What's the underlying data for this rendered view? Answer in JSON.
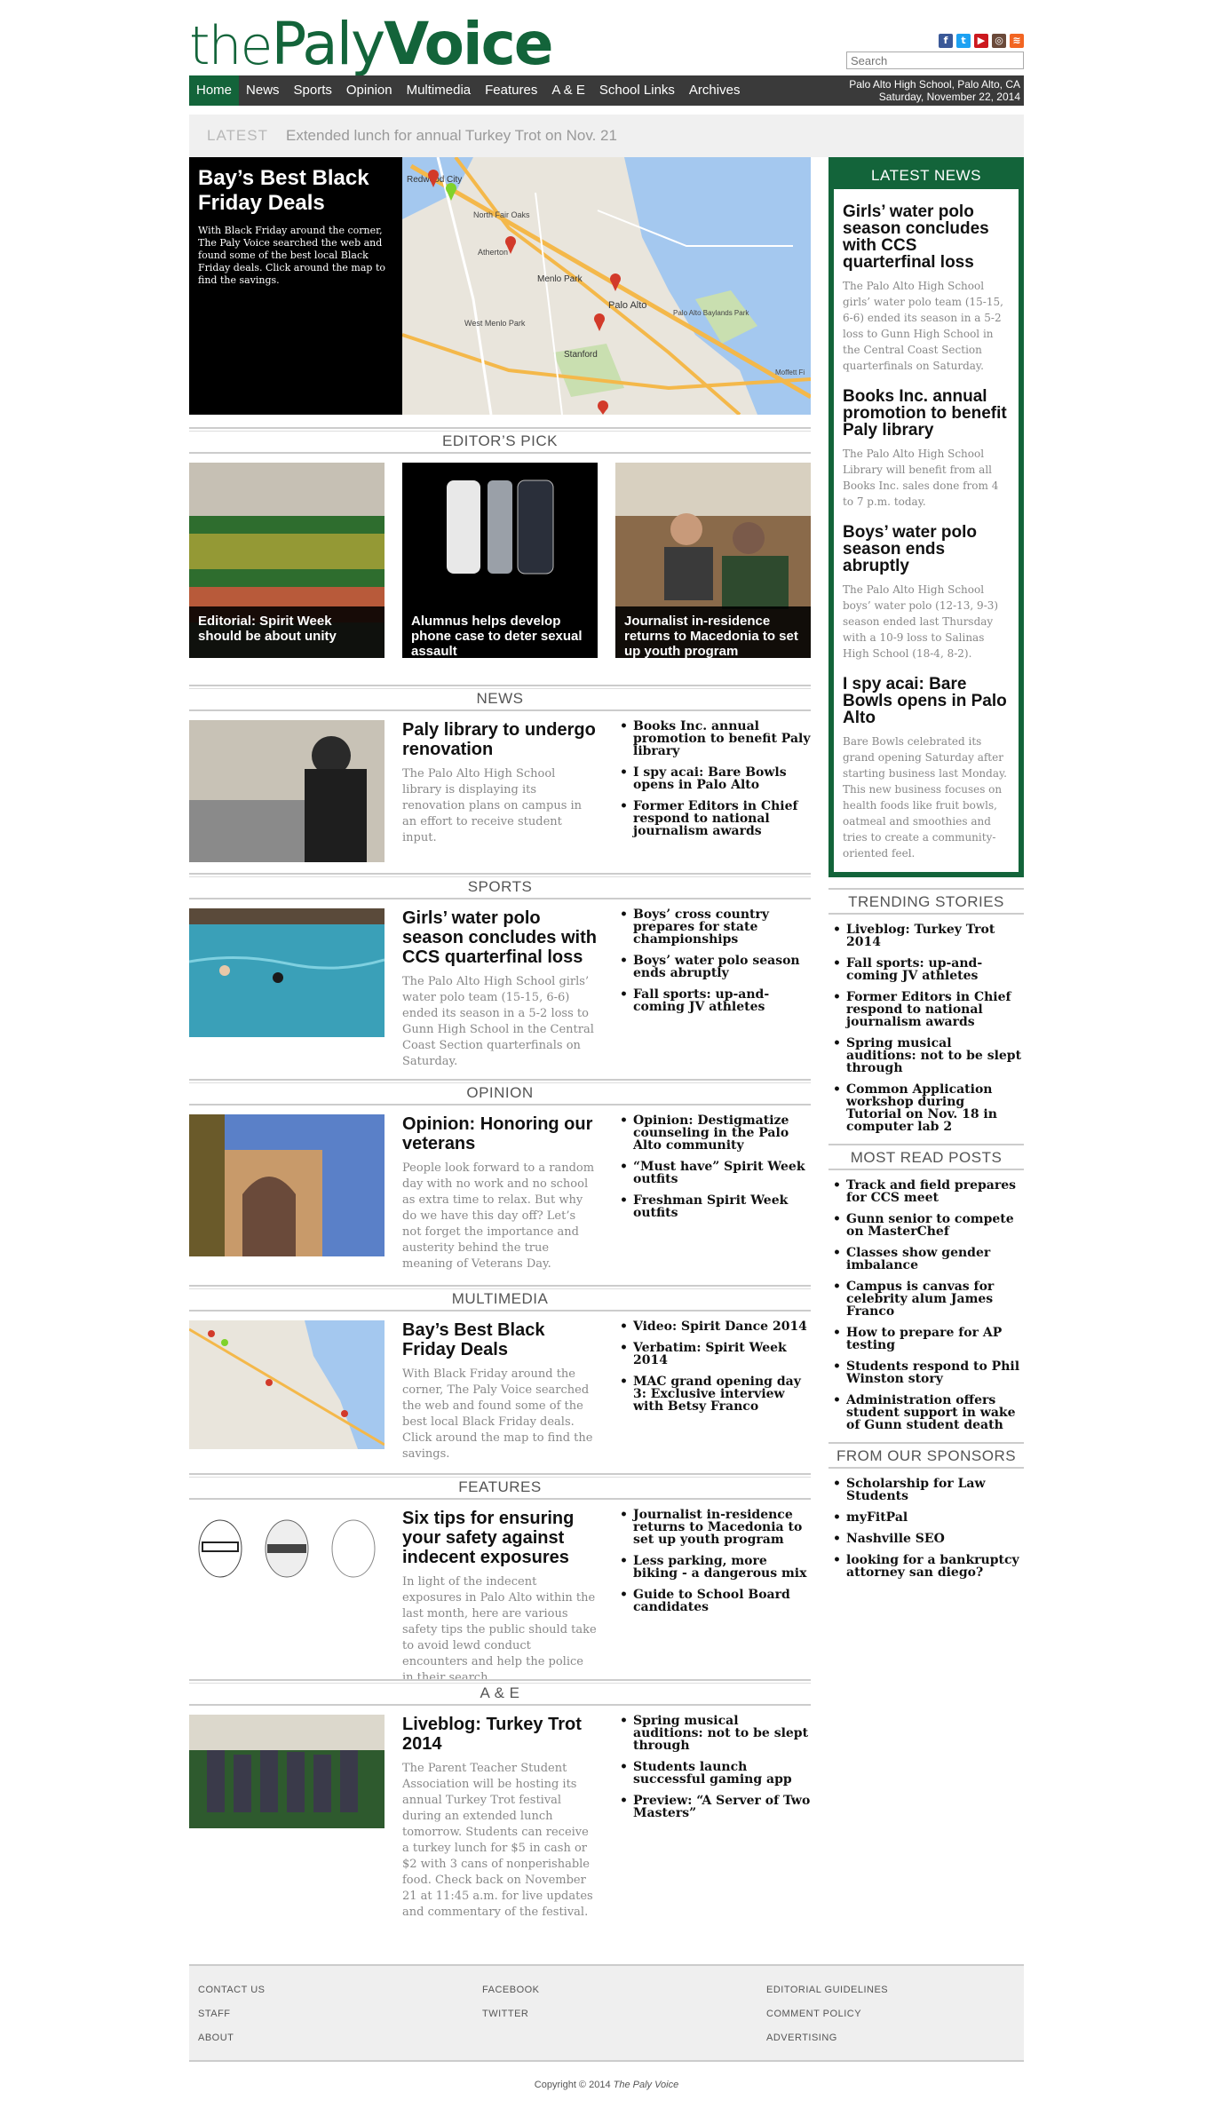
{
  "masthead": {
    "logo_the": "the",
    "logo_paly": "Paly",
    "logo_voice": "Voice",
    "search_placeholder": "Search",
    "social_icons": [
      "facebook-icon",
      "twitter-icon",
      "youtube-icon",
      "instagram-icon",
      "rss-icon"
    ]
  },
  "nav": {
    "items": [
      "Home",
      "News",
      "Sports",
      "Opinion",
      "Multimedia",
      "Features",
      "A & E",
      "School Links",
      "Archives"
    ],
    "location": "Palo Alto High School, Palo Alto, CA",
    "date": "Saturday, November 22, 2014"
  },
  "ticker": {
    "label": "LATEST",
    "text": "Extended lunch for annual Turkey Trot on Nov. 21"
  },
  "hero": {
    "title": "Bay’s Best Black Friday Deals",
    "text": "With Black Friday around the corner, The Paly Voice searched the web and found some of the best local Black Friday deals. Click around the map to find the savings.",
    "map_labels": [
      "Redwood City",
      "North Fair Oaks",
      "Atherton",
      "Menlo Park",
      "West Menlo Park",
      "Palo Alto",
      "Stanford",
      "Palo Alto Baylands Park",
      "Moffett Fi"
    ]
  },
  "editors_pick": {
    "heading": "EDITOR’S PICK",
    "items": [
      "Editorial: Spirit Week should be about unity",
      "Alumnus helps develop phone case to deter sexual assault",
      "Journalist in-residence returns to Macedonia to set up youth program"
    ]
  },
  "sections": [
    {
      "heading": "NEWS",
      "title": "Paly library to undergo renovation",
      "text": "The Palo Alto High School library  is displaying its renovation plans on campus in an effort to receive student input.",
      "links": [
        "Books Inc. annual promotion to benefit Paly library",
        "I spy acai: Bare Bowls opens in Palo Alto",
        "Former Editors in Chief respond to national journalism awards"
      ]
    },
    {
      "heading": "SPORTS",
      "title": "Girls’ water polo season concludes with CCS quarterfinal loss",
      "text": "The Palo Alto High School girls’ water polo team (15-15, 6-6) ended its season in a 5-2 loss to Gunn High School in the Central Coast Section quarterfinals on Saturday.",
      "links": [
        "Boys’ cross country prepares for state championships",
        "Boys’ water polo season ends abruptly",
        "Fall sports: up-and-coming JV athletes"
      ]
    },
    {
      "heading": "OPINION",
      "title": "Opinion: Honoring our veterans",
      "text": "People look forward to a random day with no work and no school as extra time to relax. But why do we have this day off? Let’s not forget the importance and austerity behind the true meaning of Veterans Day.",
      "links": [
        "Opinion: Destigmatize counseling in the Palo Alto community",
        "“Must have” Spirit Week outfits",
        "Freshman Spirit Week outfits"
      ]
    },
    {
      "heading": "MULTIMEDIA",
      "title": "Bay’s Best Black Friday Deals",
      "text": "With Black Friday around the corner, The Paly Voice searched the web and found some of the best local Black Friday deals. Click around the map to find the savings.",
      "links": [
        "Video: Spirit Dance 2014",
        "Verbatim: Spirit Week 2014",
        "MAC grand opening day 3: Exclusive interview with Betsy Franco"
      ]
    },
    {
      "heading": "FEATURES",
      "title": "Six tips for ensuring your safety against indecent exposures",
      "text": "In light of the indecent exposures in Palo Alto within the last month, here are various safety tips the public should take to avoid lewd conduct encounters and help the police in their search.",
      "links": [
        "Journalist in-residence returns to Macedonia to set up youth program",
        "Less parking, more biking - a dangerous mix",
        "Guide to School Board candidates"
      ]
    },
    {
      "heading": "A & E",
      "title": "Liveblog: Turkey Trot 2014",
      "text": "The Parent Teacher Student Association will be hosting its annual Turkey Trot festival during an extended lunch tomorrow. Students can receive a turkey lunch for $5 in cash or $2 with 3 cans of nonperishable food. Check back on November 21 at 11:45 a.m. for live updates and commentary of the festival.",
      "links": [
        "Spring musical auditions: not to be slept through",
        "Students launch successful gaming app",
        "Preview: “A Server of Two Masters”"
      ]
    }
  ],
  "sidebar": {
    "latest_heading": "LATEST NEWS",
    "latest": [
      {
        "title": "Girls’ water polo season concludes with CCS quarterfinal loss",
        "text": "The Palo Alto High School girls’ water polo team (15-15, 6-6) ended its season in a 5-2 loss to Gunn High School in the Central Coast Section quarterfinals on Saturday."
      },
      {
        "title": "Books Inc. annual promotion to benefit Paly library",
        "text": "The Palo Alto High School Library will benefit from all Books Inc. sales done from 4 to 7 p.m. today."
      },
      {
        "title": "Boys’ water polo season ends abruptly",
        "text": "The Palo Alto High School boys’ water polo (12-13, 9-3) season ended last Thursday with a 10-9 loss to Salinas High School (18-4, 8-2)."
      },
      {
        "title": "I spy acai: Bare Bowls opens in Palo Alto",
        "text": "Bare Bowls celebrated its grand opening Saturday after starting business last Monday. This new business focuses on health foods like fruit bowls, oatmeal and smoothies and tries to create a community-oriented feel."
      }
    ],
    "trending_heading": "TRENDING STORIES",
    "trending": [
      "Liveblog: Turkey Trot 2014",
      "Fall sports: up-and-coming JV athletes",
      "Former Editors in Chief respond to national journalism awards",
      "Spring musical auditions: not to be slept through",
      "Common Application workshop during Tutorial on Nov. 18 in computer lab 2"
    ],
    "most_read_heading": "MOST READ POSTS",
    "most_read": [
      "Track and field prepares for CCS meet",
      "Gunn senior to compete on MasterChef",
      "Classes show gender imbalance",
      "Campus is canvas for celebrity alum James Franco",
      "How to prepare for AP testing",
      "Students respond to Phil Winston story",
      "Administration offers student support in wake of Gunn student death"
    ],
    "sponsors_heading": "FROM OUR SPONSORS",
    "sponsors": [
      "Scholarship for Law Students",
      "myFitPal",
      "Nashville SEO",
      "looking for a bankruptcy attorney san diego?"
    ]
  },
  "footer": {
    "col1": [
      "CONTACT US",
      "STAFF",
      "ABOUT"
    ],
    "col2": [
      "FACEBOOK",
      "TWITTER"
    ],
    "col3": [
      "EDITORIAL GUIDELINES",
      "COMMENT POLICY",
      "ADVERTISING"
    ],
    "copyright_prefix": "Copyright © 2014 ",
    "copyright_name": "The Paly Voice"
  },
  "colors": {
    "brand_green": "#13643a",
    "nav_dark": "#3a3a3a"
  }
}
